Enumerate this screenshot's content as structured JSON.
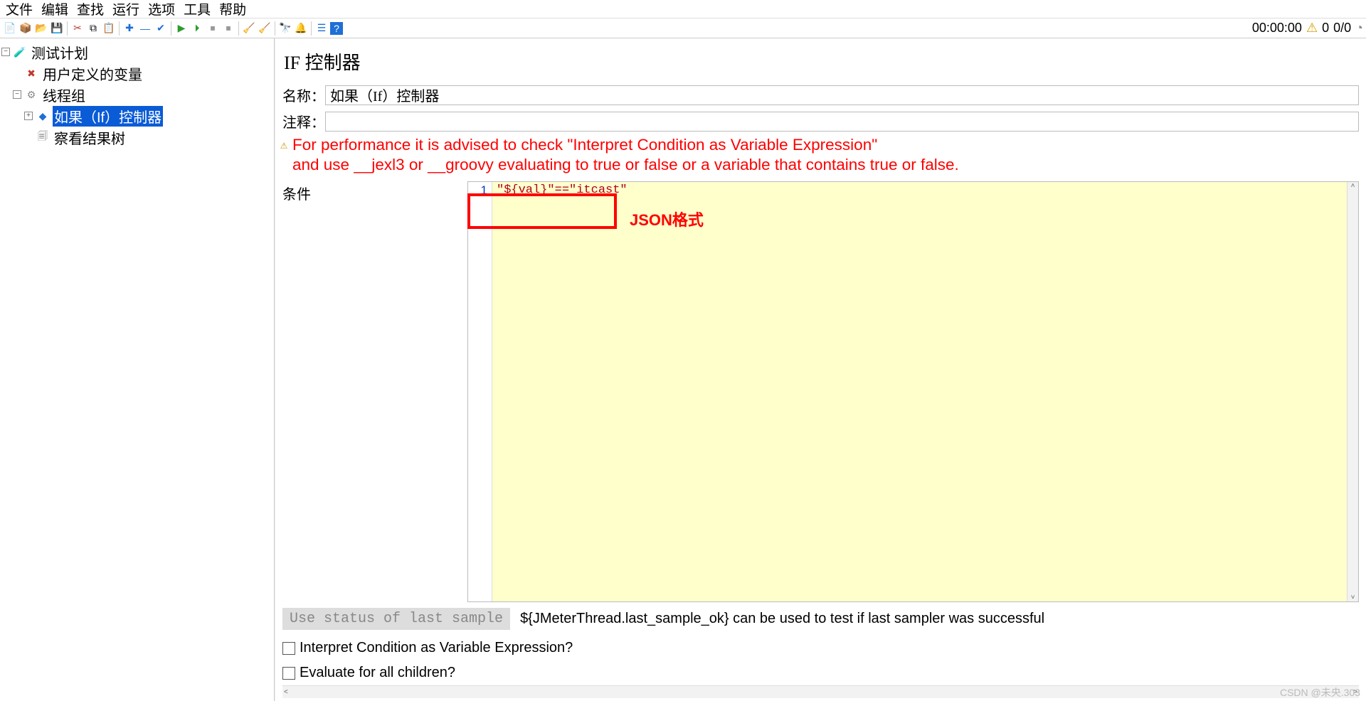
{
  "menu": {
    "items": [
      "文件",
      "编辑",
      "查找",
      "运行",
      "选项",
      "工具",
      "帮助"
    ]
  },
  "status": {
    "time": "00:00:00",
    "warn": "0",
    "ratio": "0/0"
  },
  "tree": {
    "root": "测试计划",
    "udv": "用户定义的变量",
    "tg": "线程组",
    "ifc": "如果（If）控制器",
    "vrt": "察看结果树"
  },
  "panel": {
    "title": "IF 控制器",
    "name_label": "名称：",
    "name_value": "如果（If）控制器",
    "comment_label": "注释：",
    "comment_value": "",
    "warn_line1": "For performance it is advised to check \"Interpret Condition as Variable Expression\"",
    "warn_line2": " and use __jexl3 or __groovy evaluating to true or false or a variable that contains true or false.",
    "cond_label": "条件",
    "line_no": "1",
    "cond_code": "\"${val}\"==\"itcast\"",
    "hl_text": "JSON格式",
    "last_sample_btn": "Use status of last sample",
    "last_sample_hint": "${JMeterThread.last_sample_ok} can be used to test if last sampler was successful",
    "interpret_label": "Interpret Condition as Variable Expression?",
    "evaluate_label": "Evaluate for all children?"
  },
  "watermark": "CSDN @未央.303"
}
